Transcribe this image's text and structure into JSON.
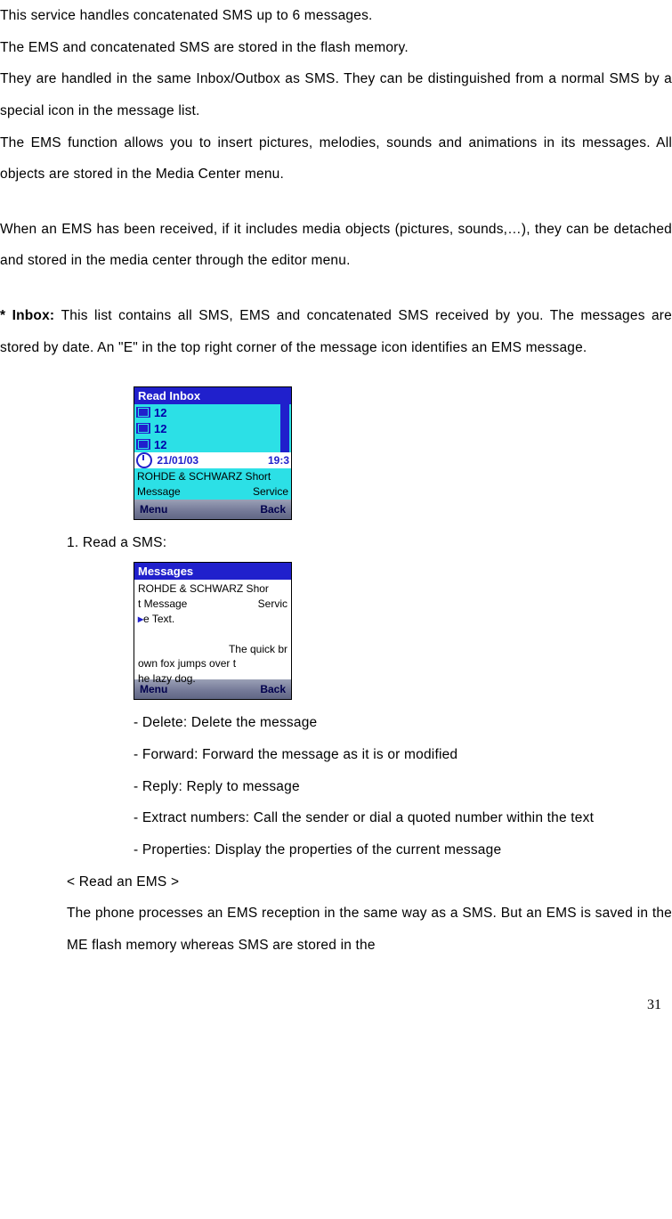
{
  "intro": {
    "l1": "This service handles concatenated SMS up to 6 messages.",
    "l2": "The EMS and concatenated SMS are stored in the flash memory.",
    "l3": "They are handled in the same Inbox/Outbox as SMS. They can be distinguished from a normal SMS by a special icon in the message list.",
    "l4": "The EMS function allows you to insert pictures, melodies, sounds and animations in its messages. All objects are stored in the Media Center menu.",
    "l5": "When an EMS has been received, if it includes media objects (pictures, sounds,…), they can be detached and stored in the media center through the editor menu."
  },
  "inbox": {
    "label": "* Inbox: ",
    "text": "This list contains all SMS, EMS and concatenated SMS received by you. The messages are stored by date. An \"E\" in the top right corner of the message icon identifies an EMS message."
  },
  "phone1": {
    "title": "Read Inbox",
    "r1": "12",
    "r2": "12",
    "r3": "12",
    "date": "21/01/03",
    "time": "19:3",
    "preview_top": "ROHDE & SCHWARZ Short",
    "preview_btmL": "Message",
    "preview_btmR": "Service",
    "menu": "Menu",
    "back": "Back"
  },
  "step1": "1. Read a SMS:",
  "phone2": {
    "title": "Messages",
    "line1": " ROHDE & SCHWARZ Shor",
    "line2a": " t Message",
    "line2b": "Servic",
    "line3": "e Text.",
    "line4": "The quick br",
    "line5": " own fox jumps over t",
    "line6": " he lazy dog.",
    "menu": "Menu",
    "back": "Back"
  },
  "opts": {
    "delete": "- Delete: Delete the message",
    "forward": "- Forward: Forward the message as it is or modified",
    "reply": "- Reply: Reply to message",
    "extract": "- Extract numbers: Call the sender or dial a quoted number within the text",
    "props": "- Properties: Display the properties of the current message"
  },
  "ems_heading": "< Read an EMS >",
  "ems_text": "The phone processes an EMS reception in the same way as a SMS. But an EMS is saved in the ME flash memory whereas SMS are stored in the",
  "page_number": "31"
}
